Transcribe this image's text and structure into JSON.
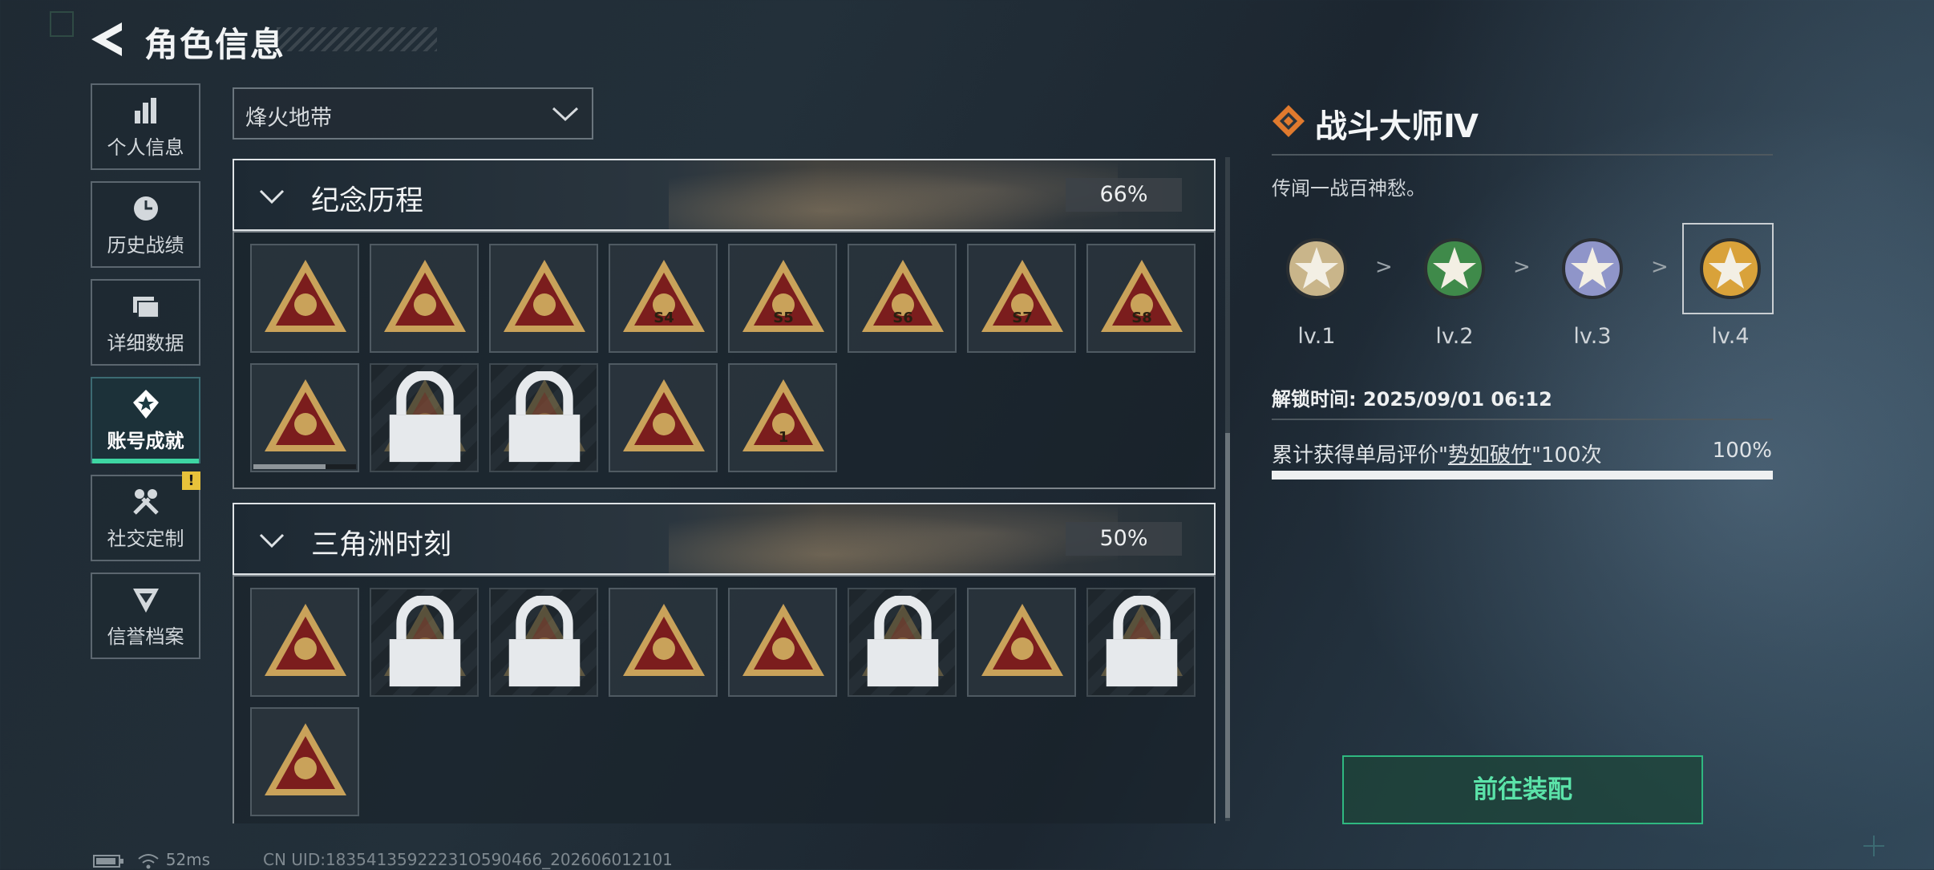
{
  "header": {
    "title": "角色信息"
  },
  "sidebar": {
    "items": [
      {
        "label": "个人信息",
        "icon": "bar-chart-icon"
      },
      {
        "label": "历史战绩",
        "icon": "clock-history-icon"
      },
      {
        "label": "详细数据",
        "icon": "folder-icon"
      },
      {
        "label": "账号成就",
        "icon": "achievement-badge-icon",
        "active": true
      },
      {
        "label": "社交定制",
        "icon": "wrench-icon",
        "alert": "!"
      },
      {
        "label": "信誉档案",
        "icon": "shield-chevron-icon"
      }
    ]
  },
  "filter": {
    "selected": "烽火地带"
  },
  "sections": [
    {
      "name": "纪念历程",
      "percent": "66%",
      "badges": [
        {
          "icon": "triangle-badge-icon",
          "locked": false
        },
        {
          "icon": "helicopter-badge-icon",
          "locked": false
        },
        {
          "icon": "shield-emblem-badge-icon",
          "locked": false
        },
        {
          "icon": "s4-badge-icon",
          "label": "S4",
          "locked": false
        },
        {
          "icon": "s5-badge-icon",
          "label": "S5",
          "locked": false
        },
        {
          "icon": "s6-badge-icon",
          "label": "S6",
          "locked": false
        },
        {
          "icon": "s7-badge-icon",
          "label": "S7",
          "locked": false
        },
        {
          "icon": "s8-badge-icon",
          "label": "S8",
          "locked": false
        },
        {
          "icon": "vehicle-badge-icon",
          "locked": false,
          "progress": 0.7
        },
        {
          "icon": "hooded-figure-badge-icon",
          "locked": true
        },
        {
          "icon": "soldier-badge-icon",
          "locked": true
        },
        {
          "icon": "hat-badge-icon",
          "locked": false
        },
        {
          "icon": "number-one-badge-icon",
          "label": "1",
          "locked": false
        }
      ]
    },
    {
      "name": "三角洲时刻",
      "percent": "50%",
      "badges": [
        {
          "icon": "drive-badge-icon",
          "locked": false
        },
        {
          "icon": "robot-badge-icon",
          "locked": true
        },
        {
          "icon": "runner-badge-icon",
          "locked": true
        },
        {
          "icon": "heart-hands-badge-icon",
          "locked": false
        },
        {
          "icon": "team-badge-icon",
          "locked": false
        },
        {
          "icon": "fighters-badge-icon",
          "locked": true
        },
        {
          "icon": "rocket-badge-icon",
          "locked": false
        },
        {
          "icon": "dragon-badge-icon",
          "locked": true
        },
        {
          "icon": "rose-diamond-badge-icon",
          "locked": false
        }
      ]
    }
  ],
  "detail": {
    "title": "战斗大师Ⅳ",
    "description": "传闻一战百神愁。",
    "levels": [
      {
        "label": "lv.1",
        "color": "#c9b58a",
        "icon": "bronze-star-medal-icon"
      },
      {
        "label": "lv.2",
        "color": "#3f8a4a",
        "icon": "green-star-medal-icon"
      },
      {
        "label": "lv.3",
        "color": "#8f95c9",
        "icon": "silver-star-medal-icon"
      },
      {
        "label": "lv.4",
        "color": "#d9a23a",
        "icon": "gold-star-medal-icon"
      }
    ],
    "arrow": ">",
    "unlock_time": "解锁时间: 2025/09/01 06:12",
    "condition_prefix": "累计获得单局评价\"",
    "condition_keyword": "势如破竹",
    "condition_suffix": "\"100次",
    "condition_percent": "100%",
    "condition_progress": 1.0,
    "equip_button": "前往装配"
  },
  "status": {
    "ping": "52ms",
    "uid": "CN UID:18354135922231O590466_202606012101"
  },
  "colors": {
    "accent": "#3ed6a3",
    "badge_gold": "#c9a25a",
    "badge_red": "#7b1d1d",
    "warning": "#e8c23a"
  }
}
